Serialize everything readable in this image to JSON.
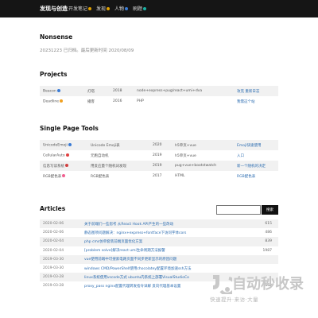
{
  "header": {
    "brand": "发现与创造",
    "nav": [
      {
        "label": "开发笔记",
        "icon_color": "#e0a000"
      },
      {
        "label": "发现",
        "icon_color": "#e0a000"
      },
      {
        "label": "人物",
        "icon_color": "#3a7bd5"
      },
      {
        "label": "刷题",
        "icon_color": "#19b3a5"
      }
    ]
  },
  "nonsense": {
    "heading": "Nonsense",
    "text": "20231223 已归档。最后更新时间 2020/08/09"
  },
  "projects": {
    "heading": "Projects",
    "rows": [
      {
        "name": "Beacon",
        "icon_color": "#3a7bd5",
        "desc": "灯塔",
        "year": "2018",
        "stack": "node+express+pug/react+umi+dva",
        "link": "攻克 重新日志"
      },
      {
        "name": "Deadline",
        "icon_color": "#f0a020",
        "desc": "播客",
        "year": "2016",
        "stack": "PHP",
        "link": "我需这个站"
      }
    ]
  },
  "tools": {
    "heading": "Single Page Tools",
    "rows": [
      {
        "name": "UnicodeEmoji",
        "icon_color": "#3a7bd5",
        "desc": "Unicode Emoji表",
        "year": "2020",
        "stack": "h5单页+vue",
        "link": "Emoji快速使用"
      },
      {
        "name": "CellularAuto",
        "icon_color": "#e04040",
        "desc": "元胞自动机",
        "year": "2019",
        "stack": "h5单页+vue",
        "link": "入口"
      },
      {
        "name": "信息写读系统",
        "icon_color": "#d04040",
        "desc": "用反应量个随机词发现",
        "year": "2019",
        "stack": "pug+vue+bootstwatch",
        "link": "新一个随机的决定"
      },
      {
        "name": "RGB配色表",
        "icon_color": "#f06090",
        "desc": "RGB配色表",
        "year": "2017",
        "stack": "HTML",
        "link": "RGB配色表"
      }
    ]
  },
  "articles": {
    "heading": "Articles",
    "search_placeholder": "",
    "search_button": "搜索",
    "rows": [
      {
        "date": "2020-02-06",
        "title": "关于前端们一些思考 从React Hook API产生的一些改动",
        "count": "615"
      },
      {
        "date": "2020-02-06",
        "title": "静态图项问题解决：nginx+express+fontface下访问字体cors",
        "count": "486"
      },
      {
        "date": "2020-02-04",
        "title": "php cms仿单套装前端页面优化方案",
        "count": "839"
      },
      {
        "date": "2020-02-04",
        "title": "[problem solve]解决react umi生命周期方法报警",
        "count": "1987"
      },
      {
        "date": "2019-03-30",
        "title": "vue使用前端中可搜索电路页面不同步更新显示的原因问题",
        "count": ""
      },
      {
        "date": "2019-03-30",
        "title": "windows CMD/PowerShell使用chocolatey配置环境加速ssh方法",
        "count": ""
      },
      {
        "date": "2019-03-28",
        "title": "linux系统使用vscode方式 ubuntu内系统上部署VisualStudioCo",
        "count": ""
      },
      {
        "date": "2019-03-28",
        "title": "proxy_pass nginx配置代理转发指令详解 反向代理基本设置",
        "count": "462"
      }
    ]
  },
  "watermark": {
    "text": "自动秒收录",
    "sub": "快速提升·来访·大量"
  }
}
